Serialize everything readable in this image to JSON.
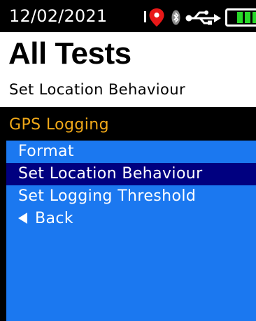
{
  "status_bar": {
    "date": "12/02/2021",
    "icons": [
      "location-pin-icon",
      "bluetooth-icon",
      "usb-icon",
      "battery-icon"
    ],
    "colors": {
      "pin": "#e81818",
      "battery": "#28d828"
    }
  },
  "header": {
    "title": "All Tests",
    "subtitle": "Set Location Behaviour"
  },
  "section": {
    "title": "GPS Logging",
    "color": "#f0a818"
  },
  "menu": {
    "background": "#1b78f0",
    "selected_background": "#000080",
    "items": [
      {
        "label": "Format",
        "selected": false
      },
      {
        "label": "Set Location Behaviour",
        "selected": true
      },
      {
        "label": "Set Logging Threshold",
        "selected": false
      },
      {
        "label": "Back",
        "selected": false,
        "icon": "back-arrow-icon"
      }
    ]
  }
}
